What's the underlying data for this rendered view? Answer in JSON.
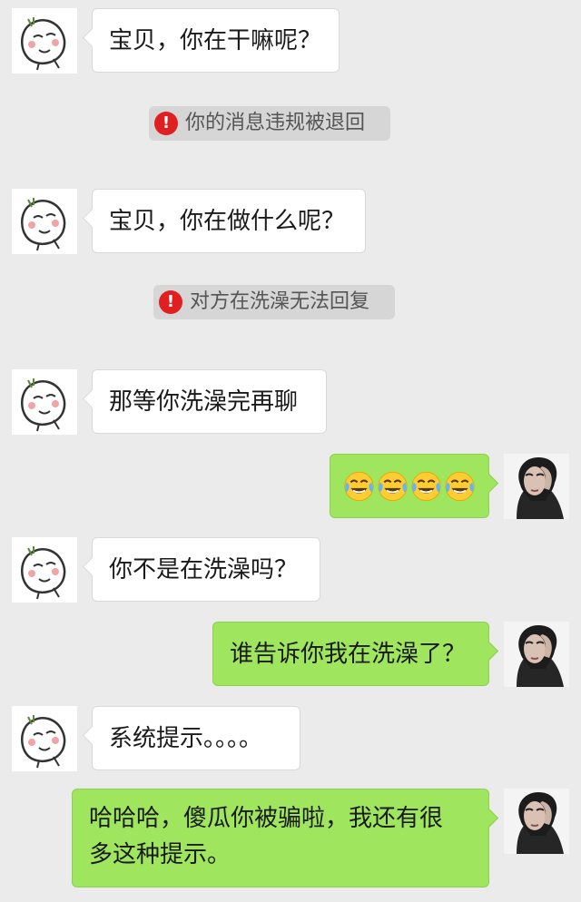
{
  "messages": [
    {
      "type": "in",
      "text": "宝贝，你在干嘛呢？"
    },
    {
      "type": "notice",
      "text": "你的消息违规被退回",
      "icon": "exclamation-icon"
    },
    {
      "type": "in",
      "text": "宝贝，你在做什么呢？"
    },
    {
      "type": "notice",
      "text": "对方在洗澡无法回复",
      "icon": "exclamation-icon"
    },
    {
      "type": "in",
      "text": "那等你洗澡完再聊"
    },
    {
      "type": "out",
      "emoji": [
        "laugh-cry-emoji",
        "laugh-cry-emoji",
        "laugh-cry-emoji",
        "laugh-cry-emoji"
      ]
    },
    {
      "type": "in",
      "text": "你不是在洗澡吗？"
    },
    {
      "type": "out",
      "text": "谁告诉你我在洗澡了？"
    },
    {
      "type": "in",
      "text": "系统提示。。。。"
    },
    {
      "type": "out",
      "lines": [
        "哈哈哈，傻瓜你被骗啦，我还有很",
        "多这种提示。"
      ]
    }
  ],
  "notice_glyph": "!",
  "colors": {
    "background": "#ebebeb",
    "incoming_bubble": "#ffffff",
    "outgoing_bubble": "#9fe65e",
    "notice_bg": "#d6d6d6",
    "warning_red": "#e02020"
  }
}
